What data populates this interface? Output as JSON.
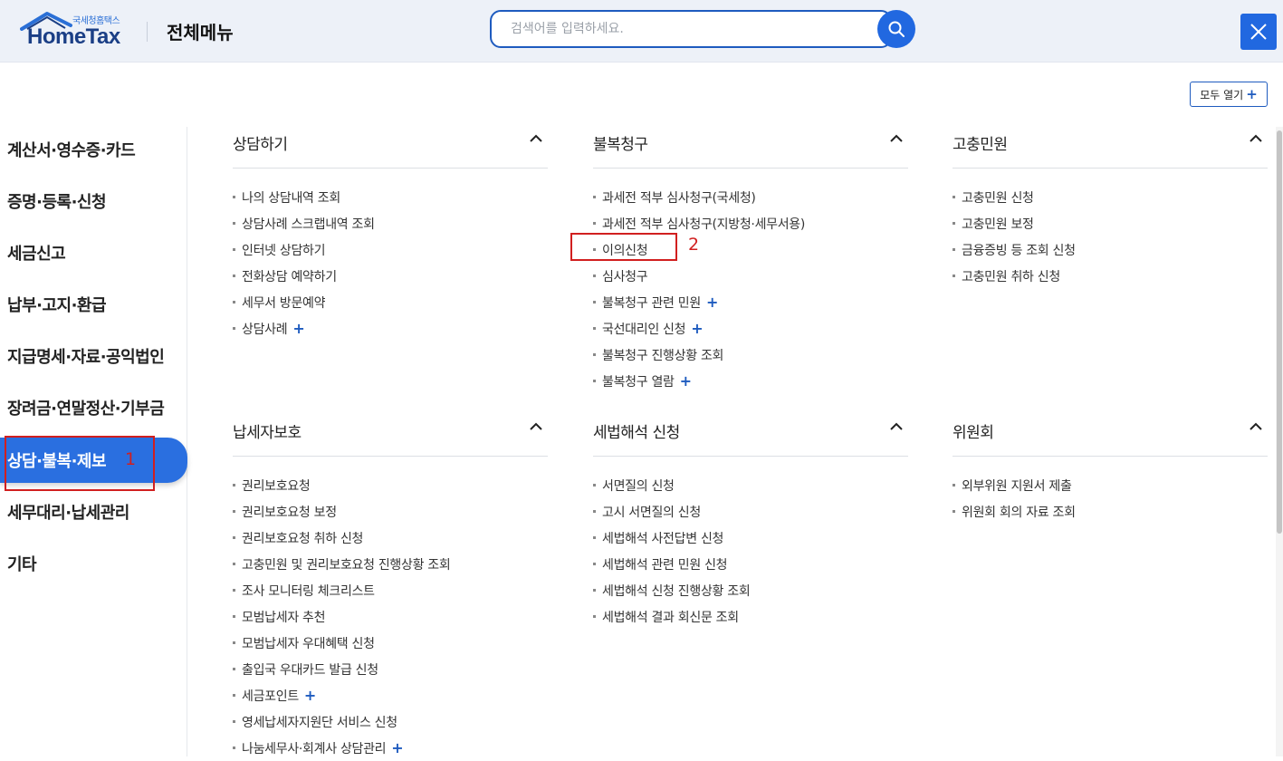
{
  "header": {
    "logo_sub": "국세청홈택스",
    "logo_main": "HomeTax",
    "title": "전체메뉴",
    "search_placeholder": "검색어를 입력하세요."
  },
  "open_all_label": "모두 열기",
  "sidebar": {
    "items": [
      {
        "label": "계산서·영수증·카드",
        "active": false
      },
      {
        "label": "증명·등록·신청",
        "active": false
      },
      {
        "label": "세금신고",
        "active": false
      },
      {
        "label": "납부·고지·환급",
        "active": false
      },
      {
        "label": "지급명세·자료·공익법인",
        "active": false
      },
      {
        "label": "장려금·연말정산·기부금",
        "active": false
      },
      {
        "label": "상담·불복·제보",
        "active": true
      },
      {
        "label": "세무대리·납세관리",
        "active": false
      },
      {
        "label": "기타",
        "active": false
      }
    ]
  },
  "sections": [
    {
      "title": "상담하기",
      "items": [
        {
          "label": "나의 상담내역 조회",
          "expand": false
        },
        {
          "label": "상담사례 스크랩내역 조회",
          "expand": false
        },
        {
          "label": "인터넷 상담하기",
          "expand": false
        },
        {
          "label": "전화상담 예약하기",
          "expand": false
        },
        {
          "label": "세무서 방문예약",
          "expand": false
        },
        {
          "label": "상담사례",
          "expand": true
        }
      ]
    },
    {
      "title": "불복청구",
      "items": [
        {
          "label": "과세전 적부 심사청구(국세청)",
          "expand": false
        },
        {
          "label": "과세전 적부 심사청구(지방청·세무서용)",
          "expand": false
        },
        {
          "label": "이의신청",
          "expand": false
        },
        {
          "label": "심사청구",
          "expand": false
        },
        {
          "label": "불복청구 관련 민원",
          "expand": true
        },
        {
          "label": "국선대리인 신청",
          "expand": true
        },
        {
          "label": "불복청구 진행상황 조회",
          "expand": false
        },
        {
          "label": "불복청구 열람",
          "expand": true
        }
      ]
    },
    {
      "title": "고충민원",
      "items": [
        {
          "label": "고충민원 신청",
          "expand": false
        },
        {
          "label": "고충민원 보정",
          "expand": false
        },
        {
          "label": "금융증빙 등 조회 신청",
          "expand": false
        },
        {
          "label": "고충민원 취하 신청",
          "expand": false
        }
      ]
    },
    {
      "title": "납세자보호",
      "items": [
        {
          "label": "권리보호요청",
          "expand": false
        },
        {
          "label": "권리보호요청 보정",
          "expand": false
        },
        {
          "label": "권리보호요청 취하 신청",
          "expand": false
        },
        {
          "label": "고충민원 및 권리보호요청 진행상황 조회",
          "expand": false
        },
        {
          "label": "조사 모니터링 체크리스트",
          "expand": false
        },
        {
          "label": "모범납세자 추천",
          "expand": false
        },
        {
          "label": "모범납세자 우대혜택 신청",
          "expand": false
        },
        {
          "label": "출입국 우대카드 발급 신청",
          "expand": false
        },
        {
          "label": "세금포인트",
          "expand": true
        },
        {
          "label": "영세납세자지원단 서비스 신청",
          "expand": false
        },
        {
          "label": "나눔세무사·회계사 상담관리",
          "expand": true
        }
      ]
    },
    {
      "title": "세법해석 신청",
      "items": [
        {
          "label": "서면질의 신청",
          "expand": false
        },
        {
          "label": "고시 서면질의 신청",
          "expand": false
        },
        {
          "label": "세법해석 사전답변 신청",
          "expand": false
        },
        {
          "label": "세법해석 관련 민원 신청",
          "expand": false
        },
        {
          "label": "세법해석 신청 진행상황 조회",
          "expand": false
        },
        {
          "label": "세법해석 결과 회신문 조회",
          "expand": false
        }
      ]
    },
    {
      "title": "위원회",
      "items": [
        {
          "label": "외부위원 지원서 제출",
          "expand": false
        },
        {
          "label": "위원회 회의 자료 조회",
          "expand": false
        }
      ]
    }
  ],
  "annotations": [
    {
      "number": "1",
      "target": "상담·불복·제보"
    },
    {
      "number": "2",
      "target": "이의신청"
    }
  ],
  "colors": {
    "accent": "#2168e0",
    "header_bg": "#edf1f8",
    "annotation": "#d11f1f"
  }
}
